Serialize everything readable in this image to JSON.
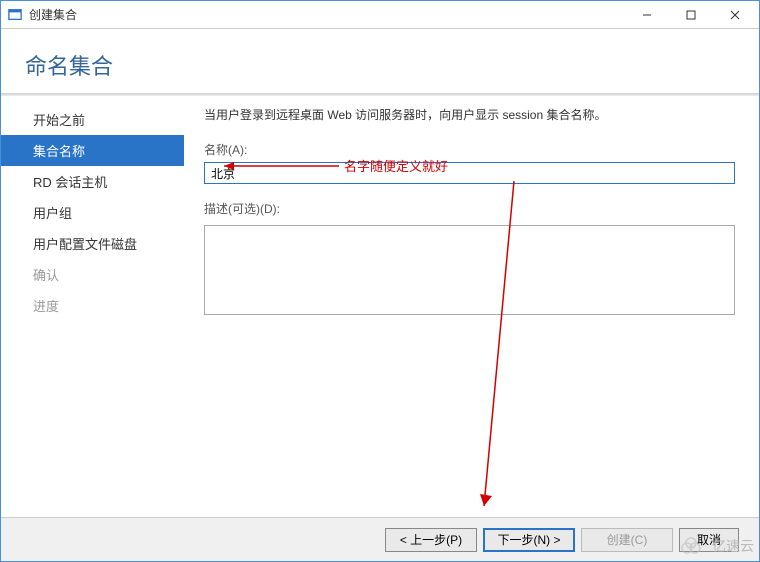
{
  "window": {
    "title": "创建集合"
  },
  "header": {
    "title": "命名集合"
  },
  "sidebar": {
    "items": [
      {
        "label": "开始之前",
        "state": "enabled"
      },
      {
        "label": "集合名称",
        "state": "active"
      },
      {
        "label": "RD 会话主机",
        "state": "enabled"
      },
      {
        "label": "用户组",
        "state": "enabled"
      },
      {
        "label": "用户配置文件磁盘",
        "state": "enabled"
      },
      {
        "label": "确认",
        "state": "disabled"
      },
      {
        "label": "进度",
        "state": "disabled"
      }
    ]
  },
  "content": {
    "intro": "当用户登录到远程桌面 Web 访问服务器时，向用户显示 session 集合名称。",
    "name_label": "名称(A):",
    "name_value": "北京",
    "desc_label": "描述(可选)(D):",
    "desc_value": ""
  },
  "annotation": {
    "text": "名字随便定义就好"
  },
  "footer": {
    "prev": "< 上一步(P)",
    "next": "下一步(N) >",
    "create": "创建(C)",
    "cancel": "取消"
  },
  "watermark": {
    "text": "亿速云"
  }
}
